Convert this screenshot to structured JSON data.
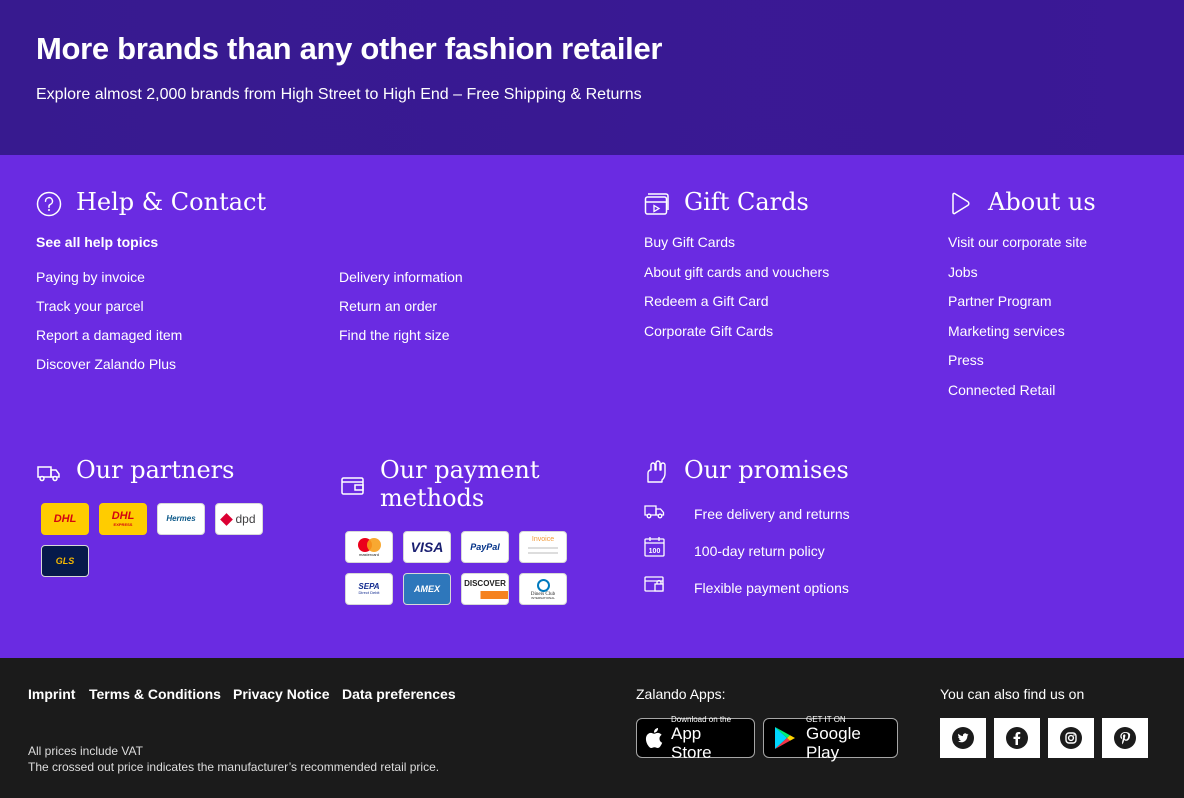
{
  "banner": {
    "title": "More brands than any other fashion retailer",
    "subtitle": "Explore almost 2,000 brands from High Street to High End – Free Shipping & Returns"
  },
  "help": {
    "title": "Help & Contact",
    "see_all": "See all help topics",
    "col1": [
      "Paying by invoice",
      "Track your parcel",
      "Report a damaged item",
      "Discover Zalando Plus"
    ],
    "col2": [
      "Delivery information",
      "Return an order",
      "Find the right size"
    ]
  },
  "gift": {
    "title": "Gift Cards",
    "items": [
      "Buy Gift Cards",
      "About gift cards and vouchers",
      "Redeem a Gift Card",
      "Corporate Gift Cards"
    ]
  },
  "about": {
    "title": "About us",
    "items": [
      "Visit our corporate site",
      "Jobs",
      "Partner Program",
      "Marketing services",
      "Press",
      "Connected Retail"
    ]
  },
  "partners": {
    "title": "Our partners",
    "logos": [
      "DHL",
      "DHL",
      "Hermes",
      "dpd",
      "GLS"
    ],
    "express_label": "EXPRESS"
  },
  "payment": {
    "title_line1": "Our payment",
    "title_line2": "methods",
    "logos": [
      "mastercard",
      "VISA",
      "PayPal",
      "Invoice",
      "SEPA",
      "AMEX",
      "DISCOVER",
      "Diners Club"
    ],
    "sepa_sub": "Direct Debit",
    "diners_sub": "INTERNATIONAL"
  },
  "promises": {
    "title": "Our promises",
    "items": [
      "Free delivery and returns",
      "100-day return policy",
      "Flexible payment options"
    ],
    "calendar_number": "100"
  },
  "footer": {
    "links": [
      "Imprint",
      "Terms & Conditions",
      "Privacy Notice",
      "Data preferences"
    ],
    "vat": "All prices include VAT",
    "crossed": "The crossed out price indicates the manufacturer’s recommended retail price.",
    "apps_title": "Zalando Apps:",
    "appstore_sub": "Download on the",
    "appstore_main": "App Store",
    "gplay_sub": "GET IT ON",
    "gplay_main": "Google Play",
    "social_title": "You can also find us on"
  },
  "colors": {
    "banner": "#3a1894",
    "main": "#6a2be2",
    "footer": "#1b1b1b",
    "dhl_yellow": "#ffcc00",
    "dhl_red": "#d40511"
  }
}
